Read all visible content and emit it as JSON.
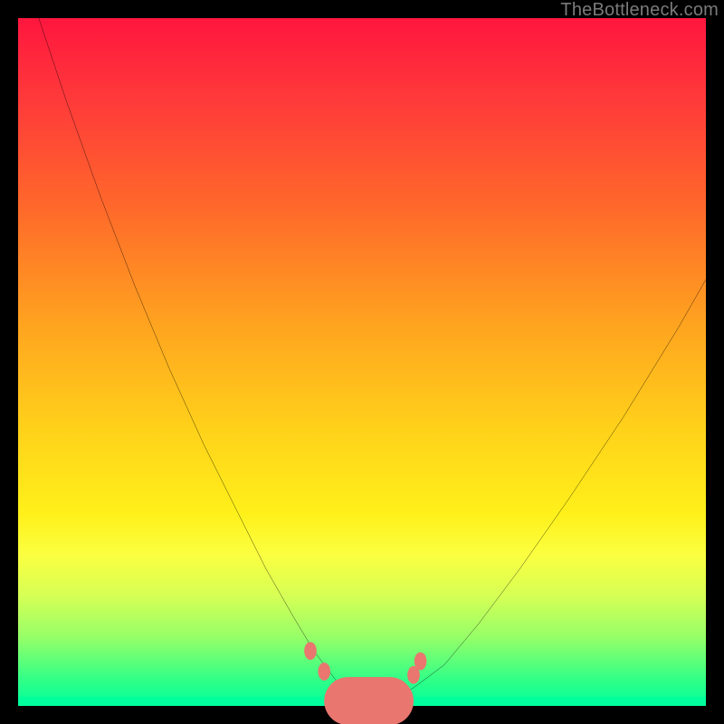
{
  "watermark": "TheBottleneck.com",
  "colors": {
    "frame": "#000000",
    "gradient_top": "#ff163e",
    "gradient_mid": "#ffe81a",
    "gradient_bottom": "#00ff9c",
    "curve": "#000000",
    "markers": "#e9766f"
  },
  "chart_data": {
    "type": "line",
    "title": "",
    "xlabel": "",
    "ylabel": "",
    "xlim": [
      0,
      100
    ],
    "ylim": [
      0,
      100
    ],
    "series": [
      {
        "name": "bottleneck-curve",
        "x": [
          0,
          3,
          7,
          12,
          17,
          22,
          27,
          32,
          36,
          40,
          43,
          46,
          48,
          50,
          52,
          55,
          58,
          62,
          67,
          73,
          80,
          88,
          96,
          100
        ],
        "y": [
          110,
          100,
          88,
          74,
          61,
          49,
          38,
          28,
          20,
          13,
          8,
          4,
          1.5,
          0.5,
          0.5,
          1,
          3,
          6,
          12,
          20,
          30,
          42,
          55,
          62
        ]
      }
    ],
    "markers": [
      {
        "x": 42.5,
        "y": 8
      },
      {
        "x": 44.5,
        "y": 5
      },
      {
        "x": 46.5,
        "y": 2.5
      },
      {
        "x": 55.5,
        "y": 2.5
      },
      {
        "x": 57.5,
        "y": 4.5
      },
      {
        "x": 58.5,
        "y": 6.5
      }
    ],
    "flat_segment": {
      "x0": 48,
      "x1": 54,
      "y": 0.7,
      "thickness": 7
    }
  }
}
